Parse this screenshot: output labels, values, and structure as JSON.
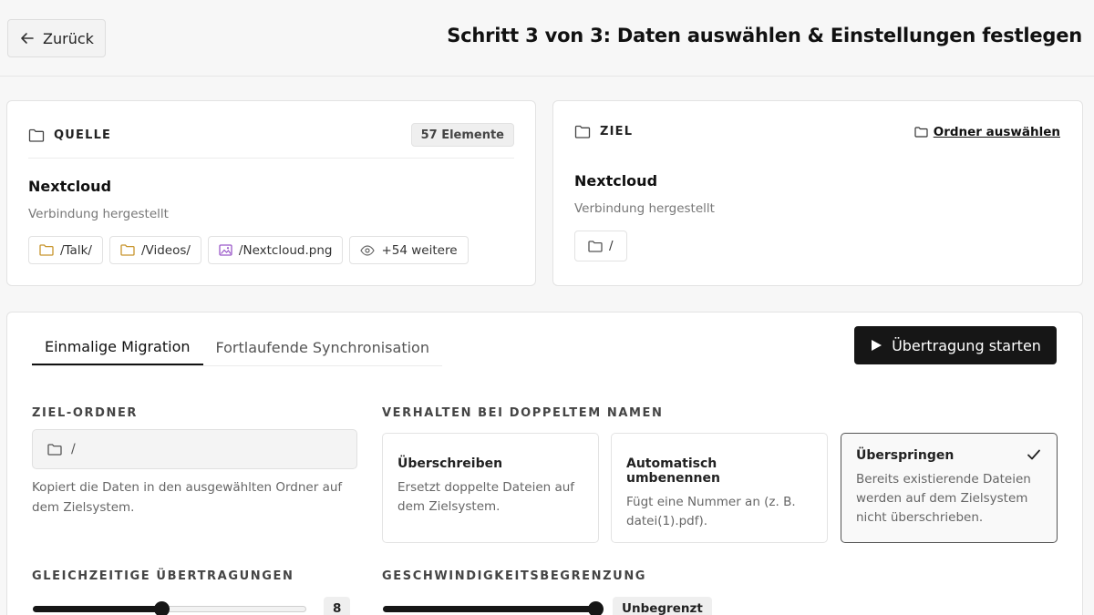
{
  "header": {
    "back_label": "Zurück",
    "title": "Schritt 3 von 3: Daten auswählen & Einstellungen festlegen"
  },
  "source": {
    "label": "QUELLE",
    "count_badge": "57 Elemente",
    "service_name": "Nextcloud",
    "status": "Verbindung hergestellt",
    "items": [
      {
        "icon": "folder-icon",
        "label": "/Talk/"
      },
      {
        "icon": "folder-icon",
        "label": "/Videos/"
      },
      {
        "icon": "image-icon",
        "label": "/Nextcloud.png"
      },
      {
        "icon": "eye-icon",
        "label": "+54 weitere"
      }
    ]
  },
  "target": {
    "label": "ZIEL",
    "folder_select_label": "Ordner auswählen",
    "service_name": "Nextcloud",
    "status": "Verbindung hergestellt",
    "path": "/"
  },
  "settings": {
    "tabs": [
      {
        "label": "Einmalige Migration",
        "active": true
      },
      {
        "label": "Fortlaufende Synchronisation",
        "active": false
      }
    ],
    "start_label": "Übertragung starten",
    "target_folder": {
      "label": "ZIEL-ORDNER",
      "value": "/",
      "help": "Kopiert die Daten in den ausgewählten Ordner auf dem Zielsystem."
    },
    "duplicate": {
      "label": "VERHALTEN BEI DOPPELTEM NAMEN",
      "options": [
        {
          "title": "Überschreiben",
          "desc": "Ersetzt doppelte Dateien auf dem Zielsystem.",
          "selected": false
        },
        {
          "title": "Automatisch umbenennen",
          "desc": "Fügt eine Nummer an (z. B. datei(1).pdf).",
          "selected": false
        },
        {
          "title": "Überspringen",
          "desc": "Bereits existierende Dateien werden auf dem Zielsystem nicht überschrieben.",
          "selected": true
        }
      ]
    },
    "concurrent": {
      "label": "GLEICHZEITIGE ÜBERTRAGUNGEN",
      "value": "8",
      "fraction": 0.47
    },
    "speed": {
      "label": "GESCHWINDIGKEITSBEGRENZUNG",
      "value": "Unbegrenzt",
      "fraction": 1.0
    }
  },
  "colors": {
    "accent": "#161616",
    "folder_icon": "#c8952c",
    "image_icon": "#9b59c9"
  }
}
